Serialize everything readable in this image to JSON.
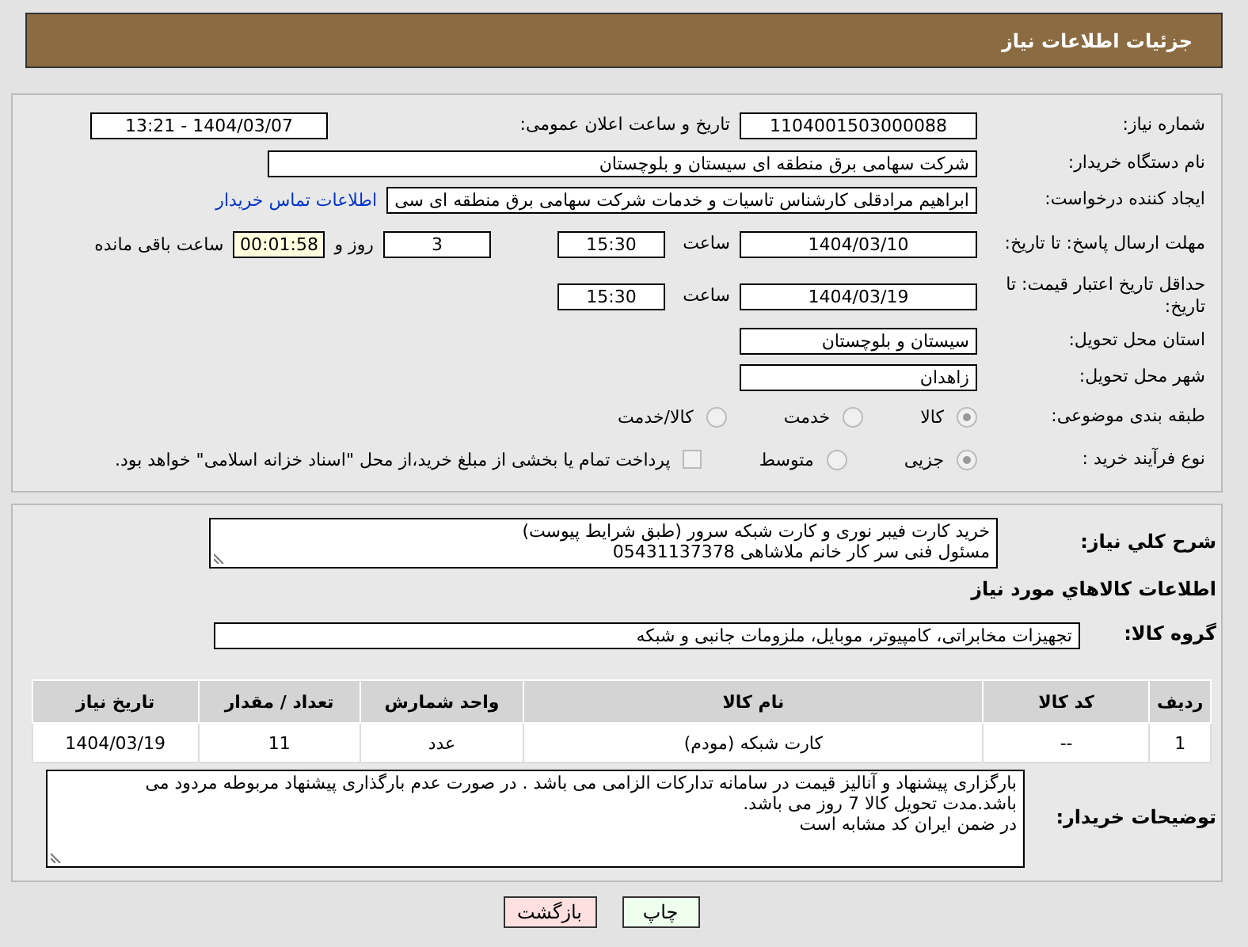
{
  "header": {
    "title": "جزئیات اطلاعات نیاز"
  },
  "need_number": {
    "label": "شماره نیاز:",
    "value": "1104001503000088"
  },
  "announce": {
    "label": "تاریخ و ساعت اعلان عمومی:",
    "value": "1404/03/07 - 13:21"
  },
  "buyer_org": {
    "label": "نام دستگاه خریدار:",
    "value": "شرکت سهامی برق منطقه ای سیستان و بلوچستان"
  },
  "creator": {
    "label": "ایجاد کننده درخواست:",
    "value": "ابراهیم مرادقلی کارشناس تاسیات و خدمات شرکت سهامی برق منطقه ای سی",
    "link": "اطلاعات تماس خریدار"
  },
  "reply_deadline": {
    "label": "مهلت ارسال پاسخ: تا تاریخ:",
    "date": "1404/03/10",
    "time_label": "ساعت",
    "time": "15:30",
    "days": "3",
    "days_label": "روز و",
    "remaining": "00:01:58",
    "remaining_label": "ساعت باقی مانده"
  },
  "price_validity": {
    "label": "حداقل تاریخ اعتبار قیمت: تا تاریخ:",
    "date": "1404/03/19",
    "time_label": "ساعت",
    "time": "15:30"
  },
  "province": {
    "label": "استان محل تحویل:",
    "value": "سیستان و بلوچستان"
  },
  "city": {
    "label": "شهر محل تحویل:",
    "value": "زاهدان"
  },
  "category": {
    "label": "طبقه بندی موضوعی:",
    "options": [
      {
        "label": "کالا",
        "selected": true
      },
      {
        "label": "خدمت",
        "selected": false
      },
      {
        "label": "کالا/خدمت",
        "selected": false
      }
    ]
  },
  "process": {
    "label": "نوع فرآیند خرید :",
    "options": [
      {
        "label": "جزیی",
        "selected": true
      },
      {
        "label": "متوسط",
        "selected": false
      }
    ],
    "treasury": {
      "checked": false,
      "label": "پرداخت تمام یا بخشی از مبلغ خرید،از محل \"اسناد خزانه اسلامی\" خواهد بود."
    }
  },
  "description": {
    "label": "شرح کلي نياز:",
    "lines": [
      "خرید کارت فیبر نوری و کارت شبکه سرور (طبق شرایط پیوست)",
      "مسئول فنی سر کار خانم ملاشاهی 05431137378"
    ]
  },
  "goods_heading": "اطلاعات كالاهاي مورد نياز",
  "goods_group": {
    "label": "گروه کالا:",
    "value": "تجهیزات مخابراتی، کامپیوتر، موبایل، ملزومات جانبی و شبکه"
  },
  "table": {
    "columns": [
      "ردیف",
      "کد کالا",
      "نام کالا",
      "واحد شمارش",
      "تعداد / مقدار",
      "تاریخ نیاز"
    ],
    "rows": [
      [
        "1",
        "--",
        "کارت شبکه (مودم)",
        "عدد",
        "11",
        "1404/03/19"
      ]
    ]
  },
  "buyer_notes": {
    "label": "توضیحات خریدار:",
    "lines": [
      "بارگزاری پیشنهاد و آنالیز قیمت در سامانه تدارکات الزامی می باشد . در صورت عدم بارگذاری پیشنهاد مربوطه مردود می باشد.مدت تحویل کالا 7 روز می باشد.",
      "در ضمن ایران کد مشابه است"
    ]
  },
  "buttons": [
    {
      "label": "چاپ",
      "kind": "print"
    },
    {
      "label": "بازگشت",
      "kind": "back"
    }
  ]
}
